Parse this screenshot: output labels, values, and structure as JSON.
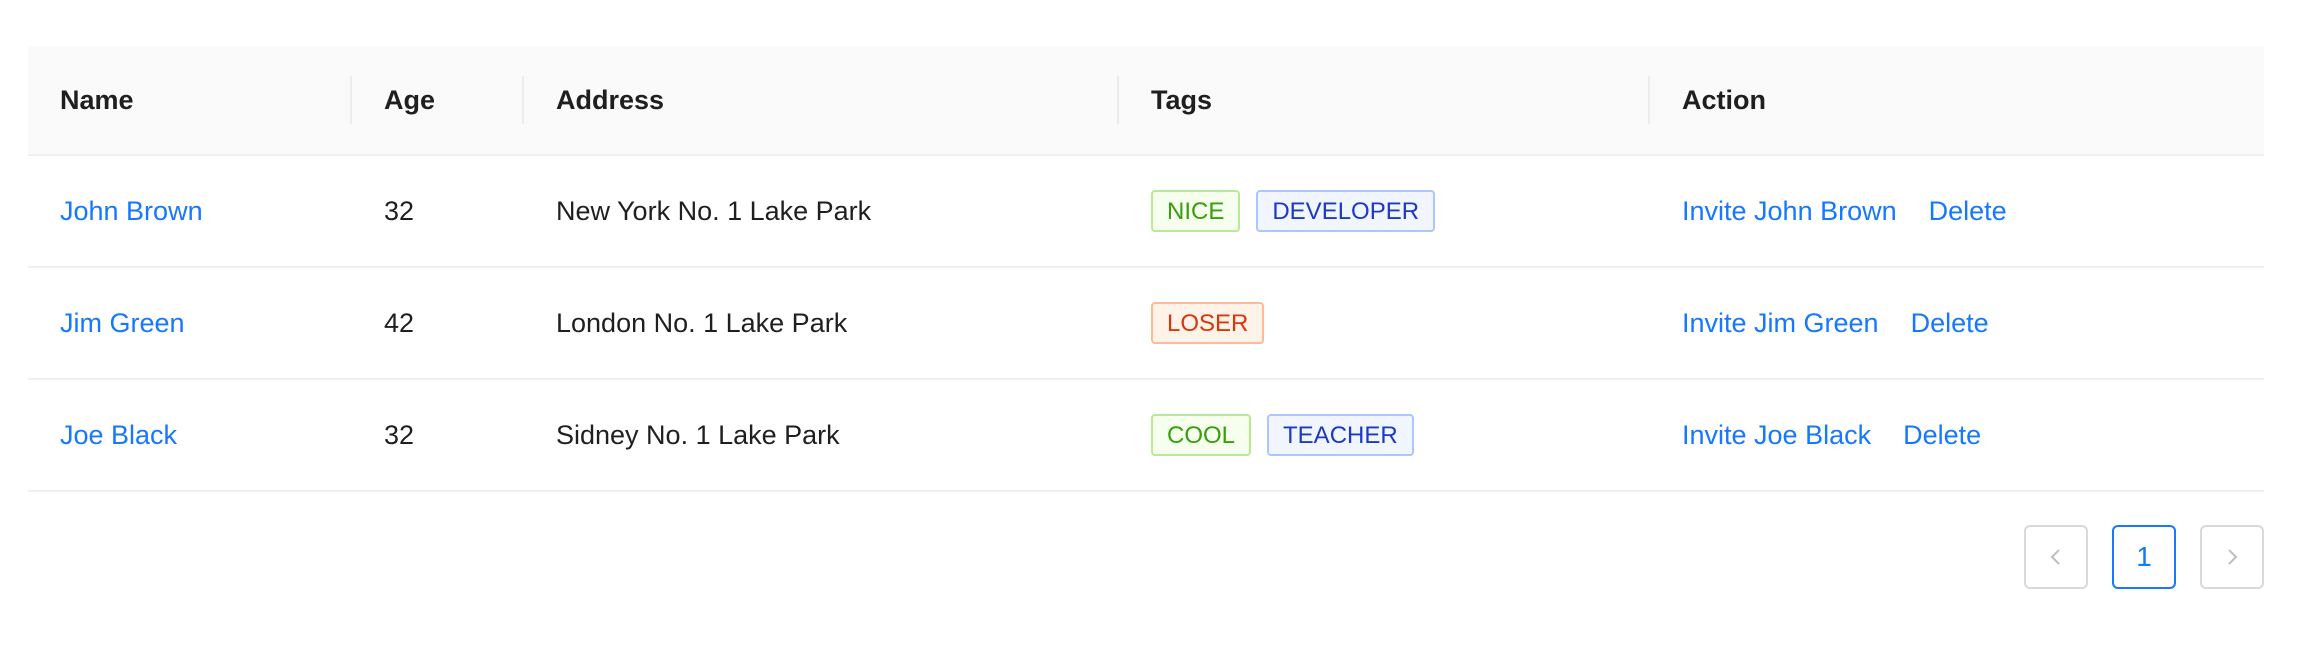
{
  "table": {
    "columns": [
      "Name",
      "Age",
      "Address",
      "Tags",
      "Action"
    ],
    "rows": [
      {
        "name": "John Brown",
        "age": "32",
        "address": "New York No. 1 Lake Park",
        "tags": [
          {
            "label": "NICE",
            "color": "green"
          },
          {
            "label": "DEVELOPER",
            "color": "geekblue"
          }
        ],
        "invite_label": "Invite John Brown",
        "delete_label": "Delete"
      },
      {
        "name": "Jim Green",
        "age": "42",
        "address": "London No. 1 Lake Park",
        "tags": [
          {
            "label": "LOSER",
            "color": "volcano"
          }
        ],
        "invite_label": "Invite Jim Green",
        "delete_label": "Delete"
      },
      {
        "name": "Joe Black",
        "age": "32",
        "address": "Sidney No. 1 Lake Park",
        "tags": [
          {
            "label": "COOL",
            "color": "green"
          },
          {
            "label": "TEACHER",
            "color": "geekblue"
          }
        ],
        "invite_label": "Invite Joe Black",
        "delete_label": "Delete"
      }
    ]
  },
  "pagination": {
    "current_page": "1",
    "prev_icon": "chevron-left-icon",
    "next_icon": "chevron-right-icon"
  },
  "colors": {
    "link": "#1677ff",
    "header_bg": "#fafafa",
    "border": "#f0f0f0"
  }
}
